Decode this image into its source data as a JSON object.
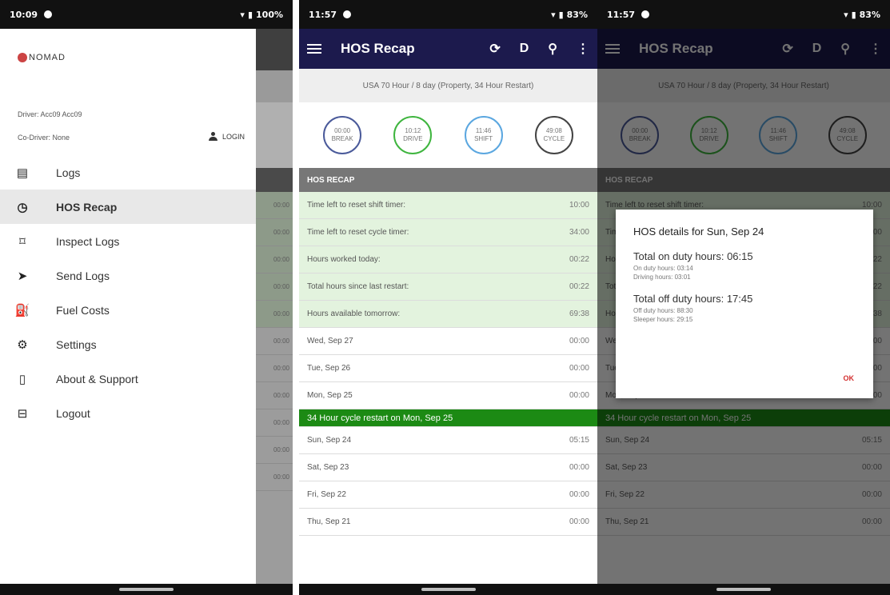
{
  "screen1": {
    "status": {
      "time": "10:09",
      "battery": "100%"
    },
    "logo": "NOMAD",
    "driver": "Driver: Acc09 Acc09",
    "codriver": "Co-Driver: None",
    "login": "LOGIN",
    "menu": [
      {
        "label": "Logs",
        "icon": "list-icon"
      },
      {
        "label": "HOS Recap",
        "icon": "alarm-clock-icon"
      },
      {
        "label": "Inspect Logs",
        "icon": "inspect-icon"
      },
      {
        "label": "Send Logs",
        "icon": "send-icon"
      },
      {
        "label": "Fuel Costs",
        "icon": "fuel-icon"
      },
      {
        "label": "Settings",
        "icon": "gear-icon"
      },
      {
        "label": "About & Support",
        "icon": "phone-icon"
      },
      {
        "label": "Logout",
        "icon": "logout-icon"
      }
    ],
    "bg_values": [
      "00:00",
      "00:00",
      "00:00",
      "00:00",
      "00:00",
      "00:00",
      "00:00",
      "00:00",
      "00:00",
      "00:00",
      "00:00"
    ]
  },
  "screen2": {
    "status": {
      "time": "11:57",
      "battery": "83%"
    },
    "title": "HOS Recap",
    "mode": "D",
    "ruleset": "USA 70 Hour / 8 day (Property, 34 Hour Restart)",
    "gauges": [
      {
        "top": "00:00",
        "bottom": "BREAK",
        "color": "#4a5a9a"
      },
      {
        "top": "10:12",
        "bottom": "DRIVE",
        "color": "#3fb53f"
      },
      {
        "top": "11:46",
        "bottom": "SHIFT",
        "color": "#5ba7e0"
      },
      {
        "top": "49:08",
        "bottom": "CYCLE",
        "color": "#444444"
      }
    ],
    "section": "HOS RECAP",
    "rows": [
      {
        "label": "Time left to reset shift timer:",
        "value": "10:00"
      },
      {
        "label": "Time left to reset cycle timer:",
        "value": "34:00"
      },
      {
        "label": "Hours worked today:",
        "value": "00:22"
      },
      {
        "label": "Total hours since last restart:",
        "value": "00:22"
      },
      {
        "label": "Hours available tomorrow:",
        "value": "69:38"
      }
    ],
    "days": [
      {
        "label": "Wed, Sep 27",
        "value": "00:00"
      },
      {
        "label": "Tue, Sep 26",
        "value": "00:00"
      },
      {
        "label": "Mon, Sep 25",
        "value": "00:00"
      }
    ],
    "banner": "34 Hour cycle restart on Mon, Sep 25",
    "days2": [
      {
        "label": "Sun, Sep 24",
        "value": "05:15"
      },
      {
        "label": "Sat, Sep 23",
        "value": "00:00"
      },
      {
        "label": "Fri, Sep 22",
        "value": "00:00"
      },
      {
        "label": "Thu, Sep 21",
        "value": "00:00"
      }
    ]
  },
  "screen3": {
    "status": {
      "time": "11:57",
      "battery": "83%"
    },
    "dialog": {
      "title": "HOS details for Sun, Sep 24",
      "on_duty_total": "Total on duty hours: 06:15",
      "on_duty_hours": "On duty hours: 03:14",
      "driving_hours": "Driving hours: 03:01",
      "off_duty_total": "Total off duty hours: 17:45",
      "off_duty_hours": "Off duty hours: 88:30",
      "sleeper_hours": "Sleeper hours: 29:15",
      "ok": "OK"
    }
  }
}
